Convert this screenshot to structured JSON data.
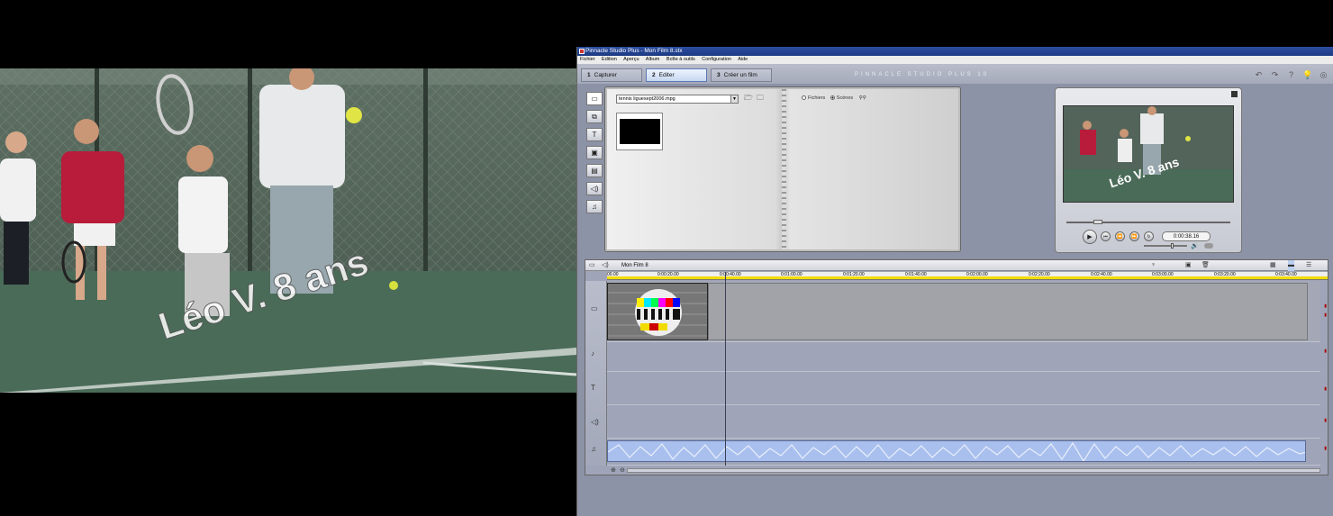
{
  "preview": {
    "overlay_text": "Léo V. 8 ans"
  },
  "window": {
    "title": "Pinnacle Studio Plus - Mon Film 8.stx",
    "menu": [
      "Fichier",
      "Edition",
      "Aperçu",
      "Album",
      "Boîte à outils",
      "Configuration",
      "Aide"
    ],
    "tabs": [
      {
        "num": "1",
        "label": "Capturer"
      },
      {
        "num": "2",
        "label": "Editer"
      },
      {
        "num": "3",
        "label": "Créer un film"
      }
    ],
    "brand": "PINNACLE STUDIO PLUS 10"
  },
  "album": {
    "file": "tennis liguesept2006.mpg",
    "view_options": [
      "Fichiers",
      "Scènes"
    ],
    "selected_view": "Scènes"
  },
  "player": {
    "timecode": "0:00:38.16"
  },
  "timeline": {
    "project": "Mon Film 8",
    "ticks": [
      "00.00",
      "0:00:20.00",
      "0:00:40.00",
      "0:01:00.00",
      "0:01:20.00",
      "0:01:40.00",
      "0:02:00.00",
      "0:02:20.00",
      "0:02:40.00",
      "0:03:00.00",
      "0:03:20.00",
      "0:03:40.00"
    ]
  },
  "colors": {
    "accent": "#2c4ea0",
    "ruler": "#f2dc00",
    "audio": "#a9c0ee"
  },
  "icons": [
    "video-tool-icon",
    "transition-icon",
    "title-icon",
    "photo-icon",
    "disc-menu-icon",
    "audio-fx-icon",
    "music-icon",
    "play-icon",
    "speaker-icon",
    "trash-icon",
    "lock-icon"
  ]
}
